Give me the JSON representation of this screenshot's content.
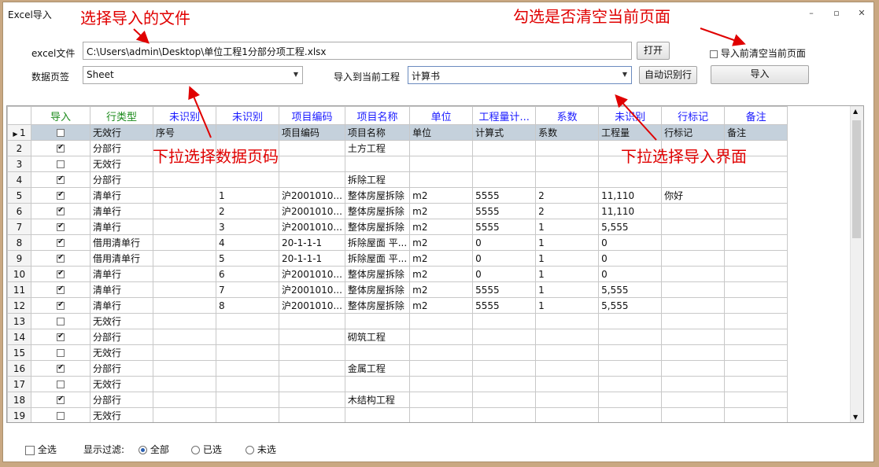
{
  "window": {
    "title": "Excel导入"
  },
  "form": {
    "excel_label": "excel文件",
    "excel_path": "C:\\Users\\admin\\Desktop\\单位工程1分部分项工程.xlsx",
    "open_button": "打开",
    "clear_checkbox_label": "导入前清空当前页面",
    "clear_checked": false,
    "sheet_label": "数据页签",
    "sheet_value": "Sheet",
    "target_label": "导入到当前工程",
    "target_value": "计算书",
    "auto_button": "自动识别行",
    "import_button": "导入"
  },
  "annotations": {
    "a1": "选择导入的文件",
    "a2": "勾选是否清空当前页面",
    "a3": "下拉选择数据页码",
    "a4": "下拉选择导入界面"
  },
  "grid": {
    "headers": [
      "导入",
      "行类型",
      "未识别",
      "未识别",
      "项目编码",
      "项目名称",
      "单位",
      "工程量计...",
      "系数",
      "未识别",
      "行标记",
      "备注"
    ],
    "rows": [
      {
        "n": "1",
        "chk": false,
        "c": [
          "无效行",
          "序号",
          "",
          "项目编码",
          "项目名称",
          "单位",
          "计算式",
          "系数",
          "工程量",
          "行标记",
          "备注"
        ]
      },
      {
        "n": "2",
        "chk": true,
        "c": [
          "分部行",
          "",
          "",
          "",
          "土方工程",
          "",
          "",
          "",
          "",
          "",
          ""
        ]
      },
      {
        "n": "3",
        "chk": false,
        "c": [
          "无效行",
          "",
          "",
          "",
          "",
          "",
          "",
          "",
          "",
          "",
          ""
        ]
      },
      {
        "n": "4",
        "chk": true,
        "c": [
          "分部行",
          "",
          "",
          "",
          "拆除工程",
          "",
          "",
          "",
          "",
          "",
          ""
        ]
      },
      {
        "n": "5",
        "chk": true,
        "c": [
          "清单行",
          "",
          "1",
          "沪2001010...",
          "整体房屋拆除",
          "m2",
          "5555",
          "2",
          "11,110",
          "你好",
          ""
        ]
      },
      {
        "n": "6",
        "chk": true,
        "c": [
          "清单行",
          "",
          "2",
          "沪2001010...",
          "整体房屋拆除",
          "m2",
          "5555",
          "2",
          "11,110",
          "",
          ""
        ]
      },
      {
        "n": "7",
        "chk": true,
        "c": [
          "清单行",
          "",
          "3",
          "沪2001010...",
          "整体房屋拆除",
          "m2",
          "5555",
          "1",
          "5,555",
          "",
          ""
        ]
      },
      {
        "n": "8",
        "chk": true,
        "c": [
          "借用清单行",
          "",
          "4",
          "20-1-1-1",
          "拆除屋面 平...",
          "m2",
          "0",
          "1",
          "0",
          "",
          ""
        ]
      },
      {
        "n": "9",
        "chk": true,
        "c": [
          "借用清单行",
          "",
          "5",
          "20-1-1-1",
          "拆除屋面 平...",
          "m2",
          "0",
          "1",
          "0",
          "",
          ""
        ]
      },
      {
        "n": "10",
        "chk": true,
        "c": [
          "清单行",
          "",
          "6",
          "沪2001010...",
          "整体房屋拆除",
          "m2",
          "0",
          "1",
          "0",
          "",
          ""
        ]
      },
      {
        "n": "11",
        "chk": true,
        "c": [
          "清单行",
          "",
          "7",
          "沪2001010...",
          "整体房屋拆除",
          "m2",
          "5555",
          "1",
          "5,555",
          "",
          ""
        ]
      },
      {
        "n": "12",
        "chk": true,
        "c": [
          "清单行",
          "",
          "8",
          "沪2001010...",
          "整体房屋拆除",
          "m2",
          "5555",
          "1",
          "5,555",
          "",
          ""
        ]
      },
      {
        "n": "13",
        "chk": false,
        "c": [
          "无效行",
          "",
          "",
          "",
          "",
          "",
          "",
          "",
          "",
          "",
          ""
        ]
      },
      {
        "n": "14",
        "chk": true,
        "c": [
          "分部行",
          "",
          "",
          "",
          "砌筑工程",
          "",
          "",
          "",
          "",
          "",
          ""
        ]
      },
      {
        "n": "15",
        "chk": false,
        "c": [
          "无效行",
          "",
          "",
          "",
          "",
          "",
          "",
          "",
          "",
          "",
          ""
        ]
      },
      {
        "n": "16",
        "chk": true,
        "c": [
          "分部行",
          "",
          "",
          "",
          "金属工程",
          "",
          "",
          "",
          "",
          "",
          ""
        ]
      },
      {
        "n": "17",
        "chk": false,
        "c": [
          "无效行",
          "",
          "",
          "",
          "",
          "",
          "",
          "",
          "",
          "",
          ""
        ]
      },
      {
        "n": "18",
        "chk": true,
        "c": [
          "分部行",
          "",
          "",
          "",
          "木结构工程",
          "",
          "",
          "",
          "",
          "",
          ""
        ]
      },
      {
        "n": "19",
        "chk": false,
        "c": [
          "无效行",
          "",
          "",
          "",
          "",
          "",
          "",
          "",
          "",
          "",
          ""
        ]
      }
    ]
  },
  "footer": {
    "select_all": "全选",
    "filter_label": "显示过滤:",
    "filters": [
      "全部",
      "已选",
      "未选"
    ],
    "filter_selected": "全部"
  }
}
